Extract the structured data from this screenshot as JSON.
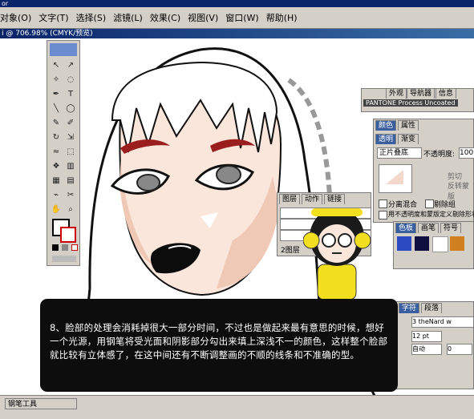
{
  "app": {
    "title": "or"
  },
  "menu": [
    "对象(O)",
    "文字(T)",
    "选择(S)",
    "滤镜(L)",
    "效果(C)",
    "视图(V)",
    "窗口(W)",
    "帮助(H)"
  ],
  "document": {
    "title": "i @ 706.98% (CMYK/预览)"
  },
  "panels": {
    "swatch_library": {
      "tabs": [
        "外观",
        "导航器",
        "信息"
      ],
      "name": "PANTONE Process Uncoated"
    },
    "transparency": {
      "tabs_top": [
        "颜色",
        "属性"
      ],
      "tabs_mid": [
        "透明",
        "渐变"
      ],
      "blend_mode": "正片叠底",
      "opacity_label": "不透明度:",
      "opacity_value": "100",
      "clip_label": "剪切",
      "invert_mask_label": "反转蒙版",
      "isolate_label": "分离混合",
      "knockout_label": "剔除组",
      "opacity_mask_label": "用不透明度和蒙版定义剔除形状"
    },
    "layers": {
      "tabs": [
        "图层",
        "动作",
        "链接"
      ],
      "count": "2图层"
    },
    "styles": {
      "tabs": [
        "色板",
        "画笔",
        "符号"
      ]
    },
    "character": {
      "tabs": [
        "字符",
        "段落"
      ],
      "font": "3 theNard w",
      "size": "12 pt",
      "tracking": "自动",
      "leading": "0"
    }
  },
  "caption": {
    "text": "8、脸部的处理会消耗掉很大一部分时间，不过也是做起来最有意思的时候，想好一个光源，用钢笔将受光面和阴影部分勾出来填上深浅不一的颜色，这样整个脸部就比较有立体感了，在这中间还有不断调整画的不顺的线条和不准确的型。"
  },
  "status": {
    "tool": "钢笔工具"
  },
  "colors": {
    "caption_bg": "#0d0d0d",
    "accent_pink": "#e040c0",
    "mascot_yellow": "#f2e020"
  }
}
